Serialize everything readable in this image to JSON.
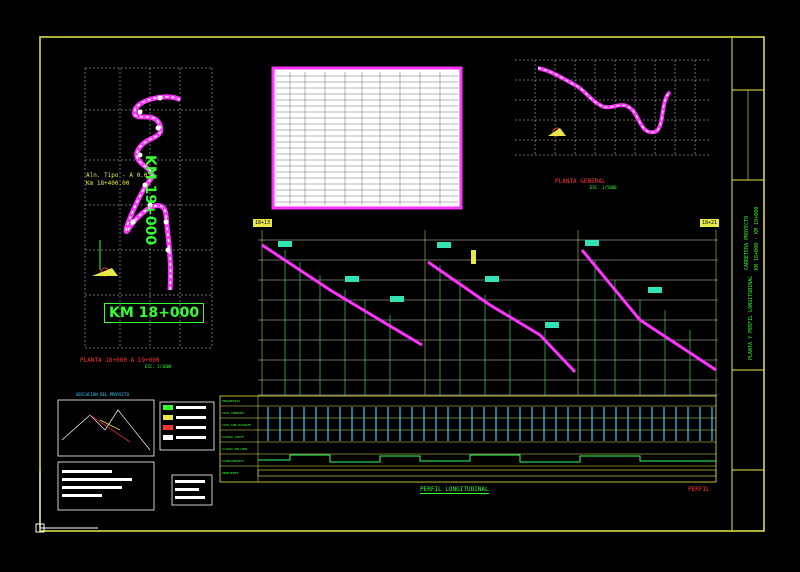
{
  "drawing": {
    "plan_km_top": "KM 19+000",
    "plan_km_bottom": "KM 18+000",
    "plan_title": "PLANTA 18+000 A 19+000",
    "plan_scale": "ESC. 1/1000",
    "plan_note_line1": "Aln. Tipo - A 0.0",
    "plan_note_line2": "Km 18+400.00",
    "general_title": "PLANTA GENERAL",
    "general_scale": "ESC. 1/5000",
    "profile_title": "PERFIL LONGITUDINAL",
    "profile_left_tag": "18+13",
    "profile_right_tag": "18+21",
    "profile_label": "PERFIL",
    "legend_title": "UBICACION DEL PROYECTO"
  },
  "profile_rows": [
    "PROGRESIVA",
    "COTA TERRENO",
    "COTA SUB RASANTE",
    "ALTURA CORTE",
    "ALTURA RELLENO",
    "ALINEAMIENTO",
    "PENDIENTE"
  ],
  "title_block": {
    "line1": "CARRETERA PROYECTO",
    "line2": "KM 18+000 - KM 19+000",
    "line3": "PLANTA Y PERFIL LONGITUDINAL"
  },
  "colors": {
    "frame": "#e8e84a",
    "grid": "#d8d8d8",
    "road": "#ff33ff",
    "label": "#33e3b3",
    "text_green": "#33ff33",
    "title_red": "#ff3333",
    "table_border": "#ff33ff",
    "cyan": "#33ccff"
  }
}
